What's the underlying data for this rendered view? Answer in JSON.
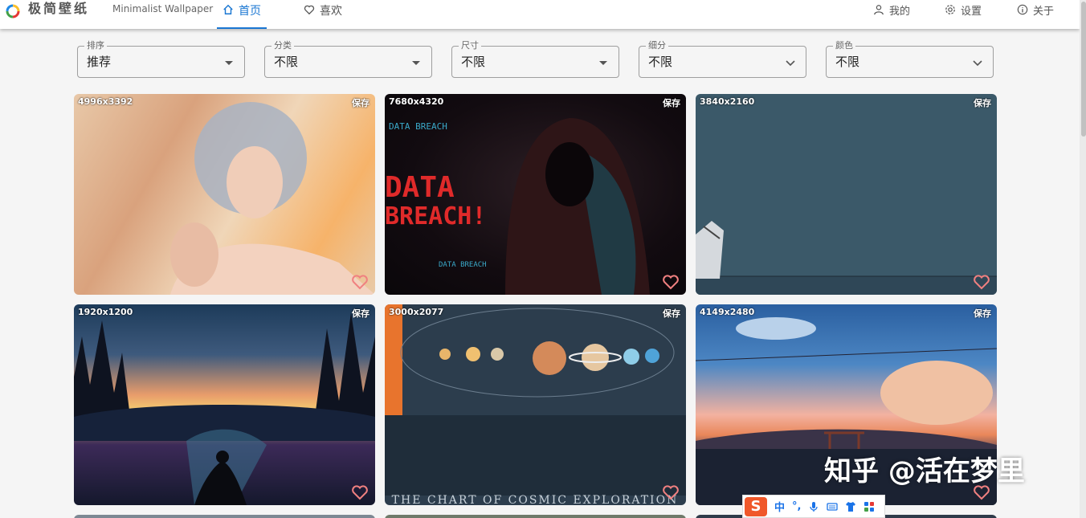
{
  "header": {
    "app_title": "极简壁纸",
    "app_subtitle": "Minimalist Wallpaper",
    "nav": {
      "home": "首页",
      "favorites": "喜欢",
      "mine": "我的",
      "settings": "设置",
      "about": "关于"
    },
    "accent_color": "#1976d2"
  },
  "filters": [
    {
      "label": "排序",
      "value": "推荐"
    },
    {
      "label": "分类",
      "value": "不限"
    },
    {
      "label": "尺寸",
      "value": "不限"
    },
    {
      "label": "细分",
      "value": "不限"
    },
    {
      "label": "颜色",
      "value": "不限"
    }
  ],
  "wallpapers": [
    {
      "size": "4996x3392",
      "save": "保存"
    },
    {
      "size": "7680x4320",
      "save": "保存",
      "text": [
        "DATA BREACH",
        "DATA",
        "BREACH!"
      ]
    },
    {
      "size": "3840x2160",
      "save": "保存"
    },
    {
      "size": "1920x1200",
      "save": "保存"
    },
    {
      "size": "3000x2077",
      "save": "保存",
      "caption": "THE CHART OF COSMIC EXPLORATION"
    },
    {
      "size": "4149x2480",
      "save": "保存"
    }
  ],
  "watermark": "知乎 @活在梦里",
  "ime": {
    "logo": "S",
    "mode": "中",
    "punct": "°,"
  }
}
